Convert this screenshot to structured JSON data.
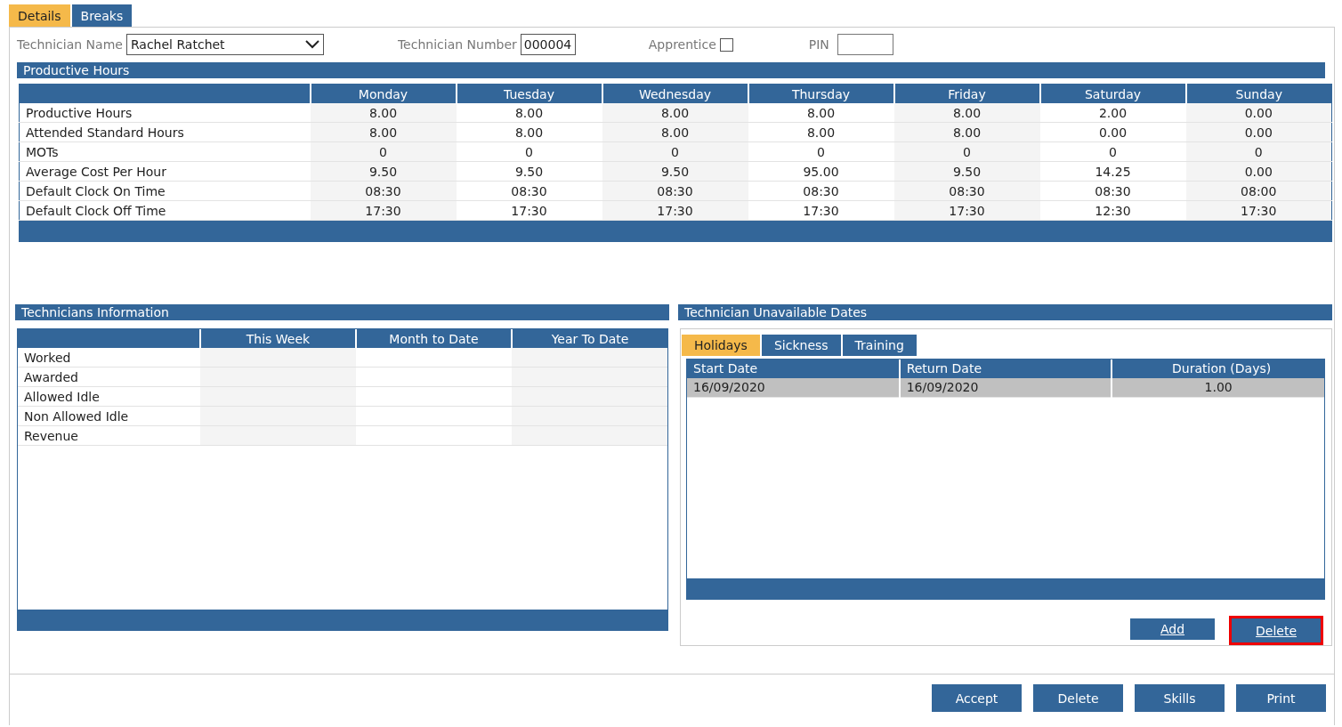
{
  "tabs": [
    {
      "label": "Details",
      "selected": true
    },
    {
      "label": "Breaks",
      "selected": false
    }
  ],
  "fields": {
    "technician_name": {
      "label": "Technician Name",
      "value": "Rachel Ratchet"
    },
    "technician_number": {
      "label": "Technician Number",
      "value": "000004"
    },
    "apprentice": {
      "label": "Apprentice",
      "checked": false
    },
    "pin": {
      "label": "PIN"
    }
  },
  "productive_hours": {
    "title": "Productive Hours",
    "columns": [
      "Monday",
      "Tuesday",
      "Wednesday",
      "Thursday",
      "Friday",
      "Saturday",
      "Sunday"
    ],
    "rows": [
      {
        "label": "Productive Hours",
        "cells": [
          "8.00",
          "8.00",
          "8.00",
          "8.00",
          "8.00",
          "2.00",
          "0.00"
        ]
      },
      {
        "label": "Attended Standard Hours",
        "cells": [
          "8.00",
          "8.00",
          "8.00",
          "8.00",
          "8.00",
          "0.00",
          "0.00"
        ]
      },
      {
        "label": "MOTs",
        "cells": [
          "0",
          "0",
          "0",
          "0",
          "0",
          "0",
          "0"
        ]
      },
      {
        "label": "Average Cost Per Hour",
        "cells": [
          "9.50",
          "9.50",
          "9.50",
          "95.00",
          "9.50",
          "14.25",
          "0.00"
        ]
      },
      {
        "label": "Default Clock On Time",
        "cells": [
          "08:30",
          "08:30",
          "08:30",
          "08:30",
          "08:30",
          "08:30",
          "08:00"
        ]
      },
      {
        "label": "Default Clock Off Time",
        "cells": [
          "17:30",
          "17:30",
          "17:30",
          "17:30",
          "17:30",
          "12:30",
          "17:30"
        ]
      }
    ]
  },
  "technicians_information": {
    "title": "Technicians Information",
    "columns": [
      "This Week",
      "Month to Date",
      "Year To Date"
    ],
    "rows": [
      "Worked",
      "Awarded",
      "Allowed Idle",
      "Non Allowed Idle",
      "Revenue"
    ]
  },
  "unavailable_dates": {
    "title": "Technician Unavailable Dates",
    "tabs": [
      {
        "label": "Holidays",
        "selected": true
      },
      {
        "label": "Sickness",
        "selected": false
      },
      {
        "label": "Training",
        "selected": false
      }
    ],
    "columns": [
      "Start Date",
      "Return Date",
      "Duration (Days)"
    ],
    "rows": [
      {
        "cells": [
          "16/09/2020",
          "16/09/2020",
          "1.00"
        ],
        "selected": true
      }
    ],
    "buttons": [
      {
        "label": "Add",
        "focused": false
      },
      {
        "label": "Delete",
        "focused": true
      }
    ]
  },
  "footer_buttons": [
    {
      "label": "Accept"
    },
    {
      "label": "Delete"
    },
    {
      "label": "Skills"
    },
    {
      "label": "Print"
    }
  ]
}
